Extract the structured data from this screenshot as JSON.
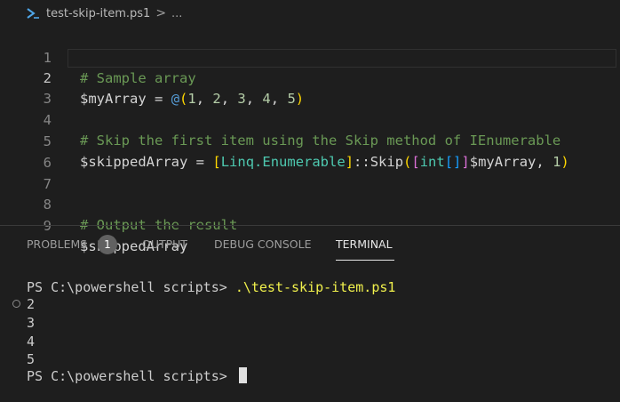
{
  "breadcrumb": {
    "icon": "powershell-icon",
    "file": "test-skip-item.ps1",
    "chevron": ">",
    "more": "..."
  },
  "editor": {
    "current_line": 2,
    "lines": [
      {
        "n": "1",
        "text": "# Sample array"
      },
      {
        "n": "2",
        "text": "$myArray = @(1, 2, 3, 4, 5)"
      },
      {
        "n": "3",
        "text": ""
      },
      {
        "n": "4",
        "text": "# Skip the first item using the Skip method of IEnumerable"
      },
      {
        "n": "5",
        "text": "$skippedArray = [Linq.Enumerable]::Skip([int[]]$myArray, 1)"
      },
      {
        "n": "6",
        "text": ""
      },
      {
        "n": "7",
        "text": ""
      },
      {
        "n": "8",
        "text": "# Output the result"
      },
      {
        "n": "9",
        "text": "$skippedArray"
      }
    ]
  },
  "panel": {
    "tabs": {
      "problems": "PROBLEMS",
      "problems_count": "1",
      "output": "OUTPUT",
      "debug_console": "DEBUG CONSOLE",
      "terminal": "TERMINAL"
    },
    "active_tab": "TERMINAL"
  },
  "terminal": {
    "prompt1": "PS C:\\powershell scripts> ",
    "command": ".\\test-skip-item.ps1",
    "output": [
      "2",
      "3",
      "4",
      "5"
    ],
    "prompt2": "PS C:\\powershell scripts> "
  },
  "colors": {
    "background": "#1e1e1e",
    "comment": "#6a9955",
    "command": "#f1f14c"
  }
}
